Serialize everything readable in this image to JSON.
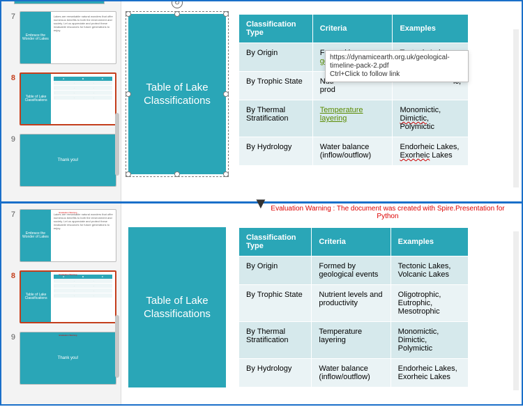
{
  "slide_numbers": {
    "s7": "7",
    "s8": "8",
    "s9": "9"
  },
  "thumbs": {
    "embrace_title": "Embrace the Wonder of Lakes",
    "embrace_body": "Lakes are remarkable natural wonders that offer numerous benefits to both the environment and society. Let us appreciate and protect these invaluable resources for future generations to enjoy.",
    "table_title": "Table of Lake Classifications",
    "thank_you": "Thank you!"
  },
  "title_box": "Table of Lake Classifications",
  "table": {
    "headers": {
      "col1": "Classification Type",
      "col2": "Criteria",
      "col3": "Examples"
    },
    "rows": [
      {
        "c1": "By Origin",
        "c2a": "Formed by ",
        "c2b": "geological events",
        "c3": "Tectonic Lakes, Volcanic Lakes"
      },
      {
        "c1": "By Trophic State",
        "c2a_top": "Nutrient levels and productivity",
        "c2b_top_pre": "Nutr",
        "c2b_top_suf": "ic,",
        "c2c_top": "prod",
        "c3_top": "Oligotrophic, Eutrophic, Mesotrophic"
      },
      {
        "c1": "By Thermal Stratification",
        "c2_link": "Temperature layering",
        "c3_pre": "Monomictic, ",
        "c3_sq": "Dimictic",
        "c3_suf": ", Polymictic"
      },
      {
        "c1": "By Hydrology",
        "c2": "Water balance (inflow/outflow)",
        "c3_pre": "Endorheic Lakes, ",
        "c3_sq": "Exorheic",
        "c3_suf": " Lakes"
      }
    ]
  },
  "tooltip": {
    "line1": "https://dynamicearth.org.uk/geological-timeline-pack-2.pdf",
    "line2": "Ctrl+Click to follow link"
  },
  "eval_warning": "Evaluation Warning : The document was created with Spire.Presentation for Python",
  "chart_data": {
    "type": "table",
    "title": "Table of Lake Classifications",
    "columns": [
      "Classification Type",
      "Criteria",
      "Examples"
    ],
    "rows": [
      [
        "By Origin",
        "Formed by geological events",
        "Tectonic Lakes, Volcanic Lakes"
      ],
      [
        "By Trophic State",
        "Nutrient levels and productivity",
        "Oligotrophic, Eutrophic, Mesotrophic"
      ],
      [
        "By Thermal Stratification",
        "Temperature layering",
        "Monomictic, Dimictic, Polymictic"
      ],
      [
        "By Hydrology",
        "Water balance (inflow/outflow)",
        "Endorheic Lakes, Exorheic Lakes"
      ]
    ]
  }
}
